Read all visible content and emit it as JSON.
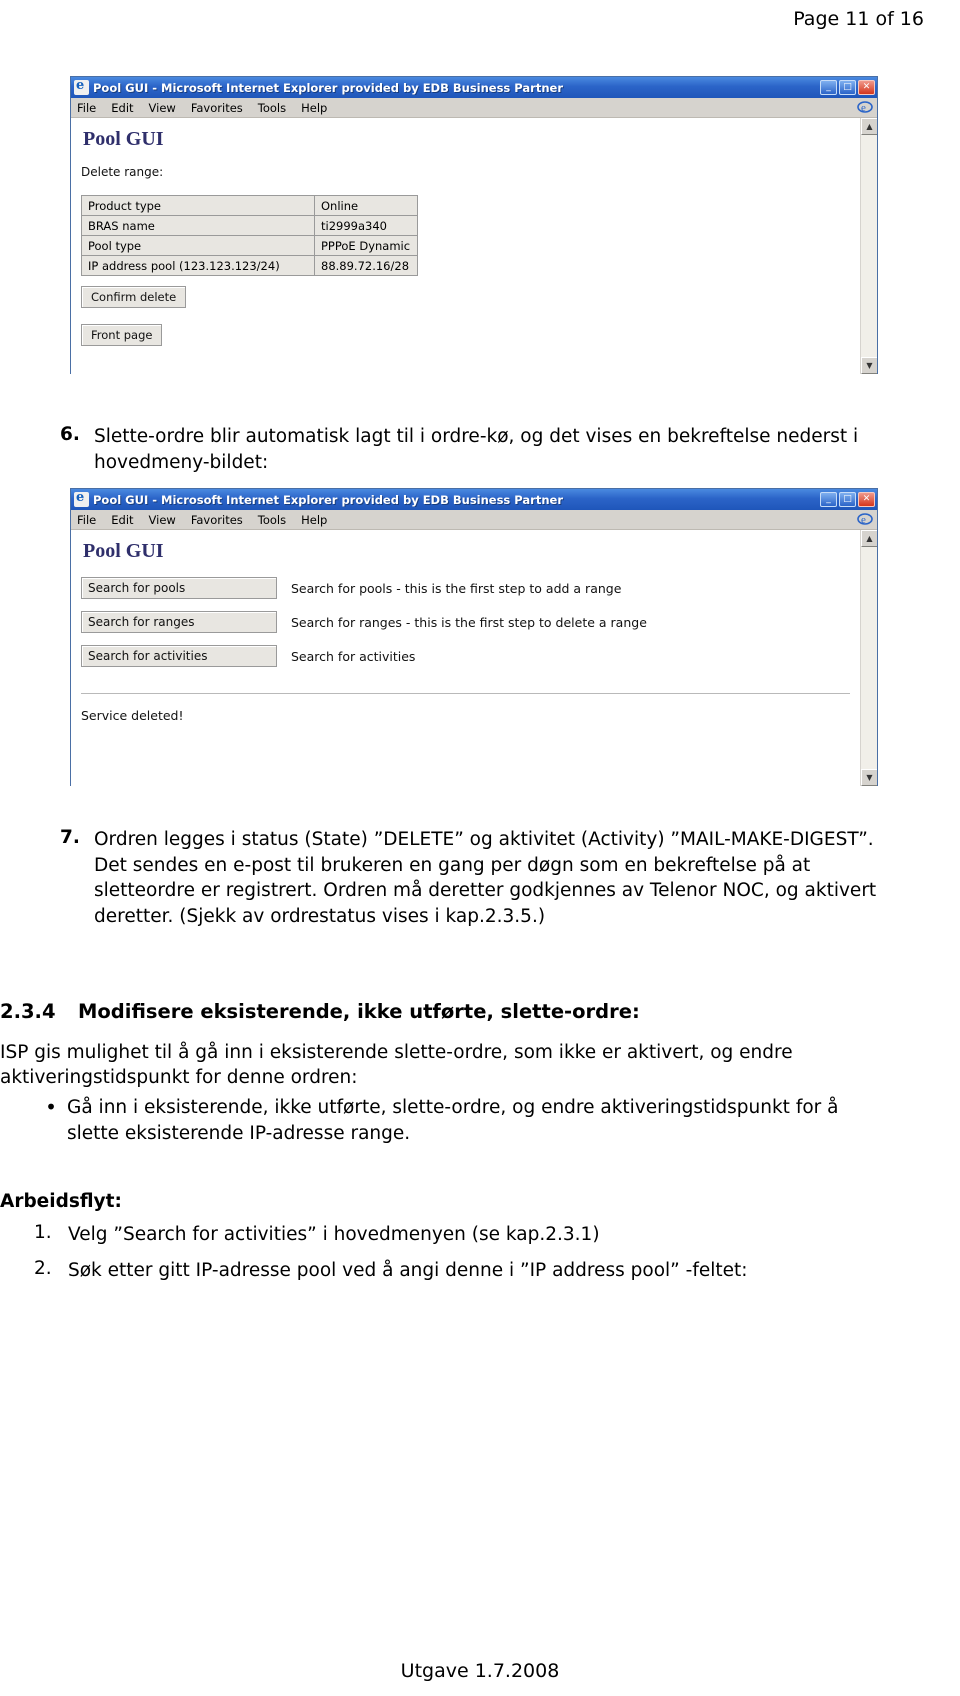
{
  "page": {
    "header": "Page 11 of 16",
    "footer": "Utgave 1.7.2008"
  },
  "window1": {
    "title": "Pool GUI - Microsoft Internet Explorer provided by EDB Business Partner",
    "icon": "ie-icon",
    "menu": [
      "File",
      "Edit",
      "View",
      "Favorites",
      "Tools",
      "Help"
    ],
    "buttons": {
      "minimize": "_",
      "maximize": "□",
      "close": "✕"
    },
    "app_title": "Pool GUI",
    "section_label": "Delete range:",
    "table": [
      {
        "key": "Product type",
        "value": "Online"
      },
      {
        "key": "BRAS name",
        "value": "ti2999a340"
      },
      {
        "key": "Pool type",
        "value": "PPPoE Dynamic"
      },
      {
        "key": "IP address pool (123.123.123/24)",
        "value": "88.89.72.16/28"
      }
    ],
    "confirm_button": "Confirm delete",
    "front_page_button": "Front page"
  },
  "step6": {
    "number": "6.",
    "text": "Slette-ordre blir automatisk lagt til i ordre-kø, og det vises en bekreftelse nederst i hovedmeny-bildet:"
  },
  "window2": {
    "title": "Pool GUI - Microsoft Internet Explorer provided by EDB Business Partner",
    "icon": "ie-icon",
    "menu": [
      "File",
      "Edit",
      "View",
      "Favorites",
      "Tools",
      "Help"
    ],
    "buttons": {
      "minimize": "_",
      "maximize": "□",
      "close": "✕"
    },
    "app_title": "Pool GUI",
    "rows": [
      {
        "button": "Search for pools",
        "description": "Search for pools - this is the first step to add a range"
      },
      {
        "button": "Search for ranges",
        "description": "Search for ranges - this is the first step to delete a range"
      },
      {
        "button": "Search for activities",
        "description": "Search for activities"
      }
    ],
    "status": "Service deleted!"
  },
  "step7": {
    "number": "7.",
    "line1_pre": "Ordren legges i status (State) ",
    "line1_quote": "”DELETE”",
    "line1_mid": " og aktivitet (Activity) ",
    "line1_quote2": "”MAIL-MAKE-DIGEST”",
    "full": "Ordren legges i status (State) ”DELETE” og aktivitet (Activity) ”MAIL-MAKE-DIGEST”. Det sendes en e-post til brukeren en gang per døgn som en bekreftelse på at sletteordre er registrert. Ordren må deretter godkjennes av Telenor NOC, og aktivert deretter. (Sjekk av ordrestatus vises i kap.2.3.5.)"
  },
  "section234": {
    "number": "2.3.4",
    "title": "Modifisere eksisterende, ikke utførte, slette-ordre:",
    "intro": "ISP gis mulighet til å gå inn i eksisterende slette-ordre, som ikke er aktivert, og endre aktiveringstidspunkt for denne ordren:",
    "bullet": "Gå inn i eksisterende, ikke utførte, slette-ordre, og endre aktiveringstidspunkt for å slette eksisterende IP-adresse range.",
    "workflow_label": "Arbeidsflyt:",
    "workflow": [
      {
        "number": "1.",
        "text": "Velg ”Search for activities” i hovedmenyen (se kap.2.3.1)"
      },
      {
        "number": "2.",
        "text": "Søk etter gitt IP-adresse pool ved å angi denne i ”IP address pool” -feltet:"
      }
    ]
  }
}
